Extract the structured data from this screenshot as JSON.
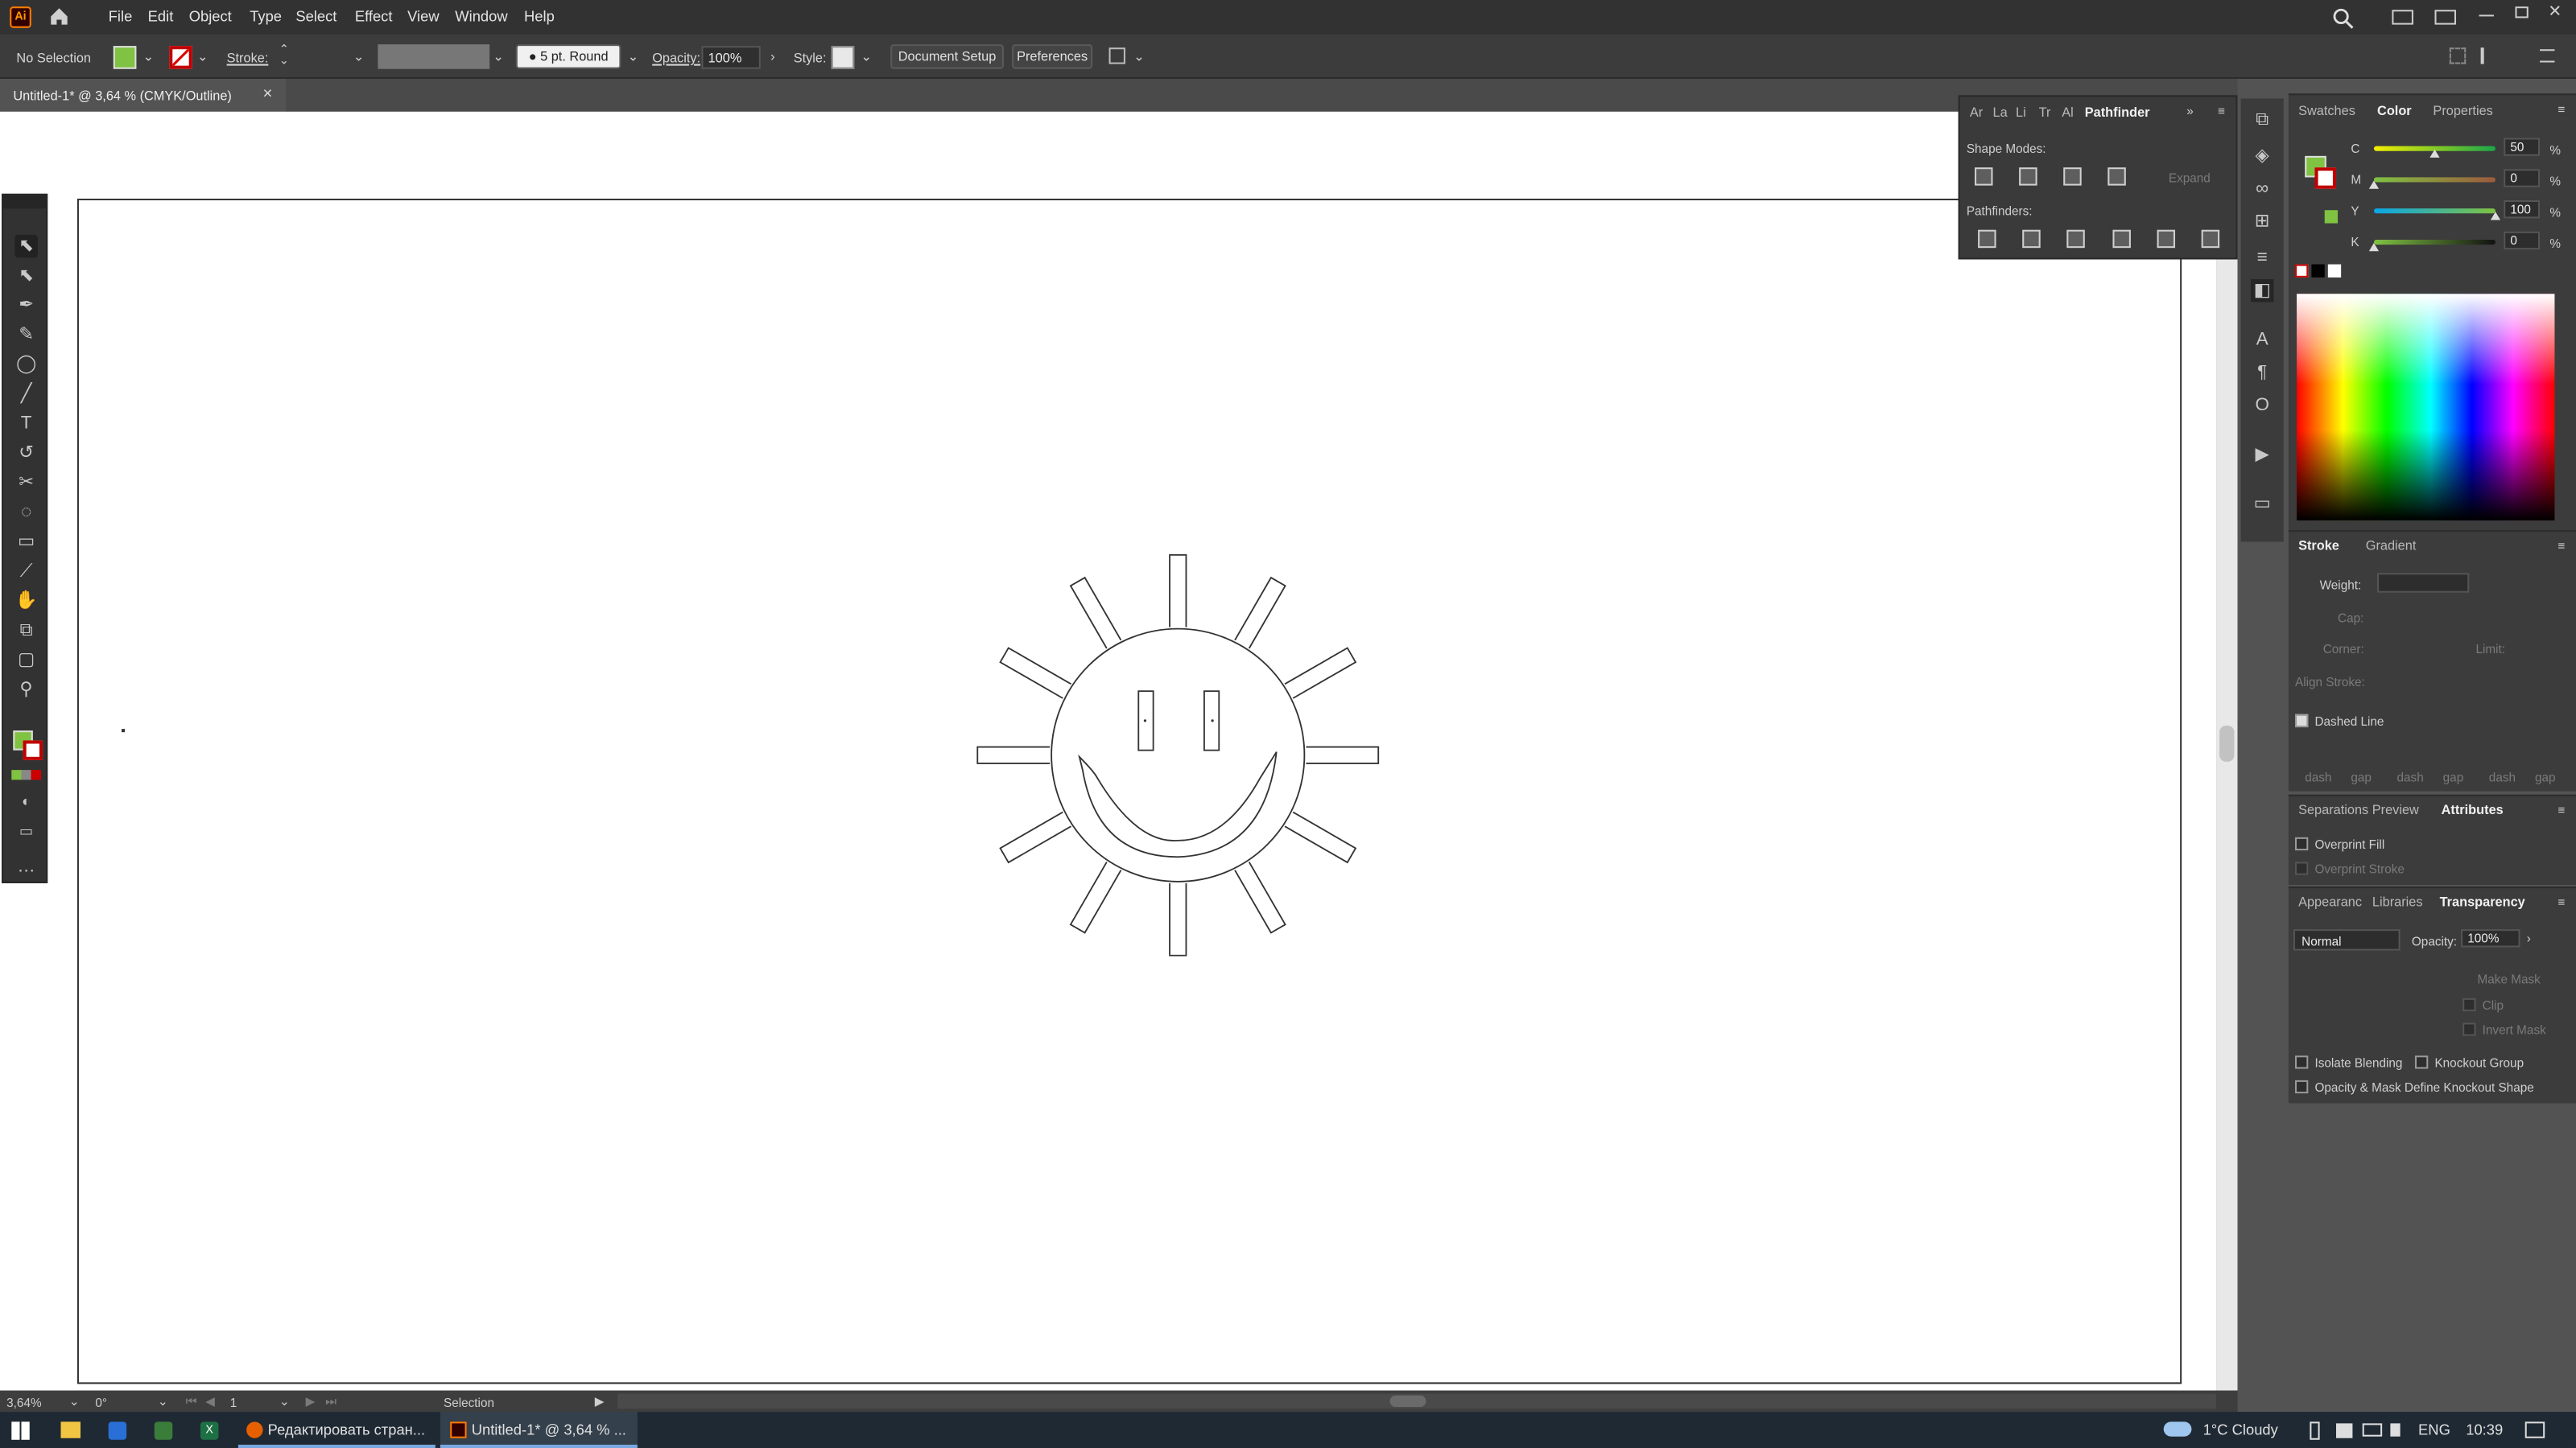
{
  "menubar": {
    "app_icon": "Ai",
    "items": [
      "File",
      "Edit",
      "Object",
      "Type",
      "Select",
      "Effect",
      "View",
      "Window",
      "Help"
    ]
  },
  "control_bar": {
    "selection": "No Selection",
    "stroke_label": "Stroke:",
    "brush": "5 pt. Round",
    "opacity_label": "Opacity:",
    "opacity_value": "100%",
    "style_label": "Style:",
    "document_setup": "Document Setup",
    "preferences": "Preferences"
  },
  "document_tab": {
    "title": "Untitled-1* @ 3,64 % (CMYK/Outline)",
    "close": "×"
  },
  "pathfinder": {
    "tabs": [
      "Ar",
      "La",
      "Li",
      "Tr",
      "Al",
      "Pathfinder"
    ],
    "shape_modes_label": "Shape Modes:",
    "expand": "Expand",
    "pathfinders_label": "Pathfinders:"
  },
  "color_panel": {
    "tabs": [
      "Swatches",
      "Color",
      "Properties"
    ],
    "channels": [
      {
        "name": "C",
        "value": "50",
        "pct": 50
      },
      {
        "name": "M",
        "value": "0",
        "pct": 0
      },
      {
        "name": "Y",
        "value": "100",
        "pct": 100
      },
      {
        "name": "K",
        "value": "0",
        "pct": 0
      }
    ],
    "unit": "%",
    "fill_color": "#80c242"
  },
  "stroke_panel": {
    "tabs": [
      "Stroke",
      "Gradient"
    ],
    "weight": "Weight:",
    "cap": "Cap:",
    "corner": "Corner:",
    "limit": "Limit:",
    "align": "Align Stroke:",
    "dashed": "Dashed Line",
    "dash_labels": [
      "dash",
      "gap",
      "dash",
      "gap",
      "dash",
      "gap"
    ]
  },
  "attributes_panel": {
    "tabs": [
      "Separations Preview",
      "Attributes"
    ],
    "overprint_fill": "Overprint Fill",
    "overprint_stroke": "Overprint Stroke"
  },
  "transparency_panel": {
    "tabs": [
      "Appearanc",
      "Libraries",
      "Transparency"
    ],
    "blend_mode": "Normal",
    "opacity_label": "Opacity:",
    "opacity_value": "100%",
    "make_mask": "Make Mask",
    "clip": "Clip",
    "invert_mask": "Invert Mask",
    "isolate": "Isolate Blending",
    "knockout": "Knockout Group",
    "define_knockout": "Opacity & Mask Define Knockout Shape"
  },
  "statusbar": {
    "zoom": "3,64%",
    "rotation": "0°",
    "artboard": "1",
    "tool": "Selection"
  },
  "taskbar": {
    "apps": [
      {
        "label": "Редактировать стран..."
      },
      {
        "label": "Untitled-1* @ 3,64 % ..."
      }
    ],
    "weather": "1°C  Cloudy",
    "lang": "ENG",
    "time": "10:39"
  }
}
